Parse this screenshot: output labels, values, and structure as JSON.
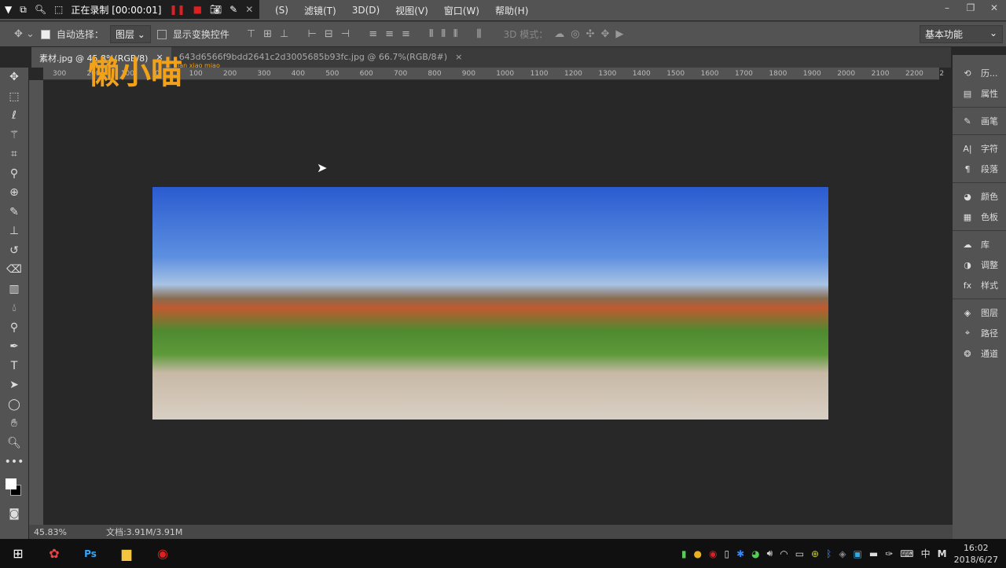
{
  "recorder": {
    "status": "正在录制 [00:00:01]"
  },
  "menu": [
    "(S)",
    "滤镜(T)",
    "3D(D)",
    "视图(V)",
    "窗口(W)",
    "帮助(H)"
  ],
  "options": {
    "auto_select_label": "自动选择：",
    "auto_select_checked": true,
    "target": "图层",
    "show_transform_label": "显示变换控件",
    "show_transform_checked": false,
    "mode3d_label": "3D 模式：",
    "workspace": "基本功能"
  },
  "tabs": [
    {
      "label": "素材.jpg @ 45.8%(RGB/8)",
      "active": true
    },
    {
      "label": "643d6566f9bdd2641c2d3005685b93fc.jpg @ 66.7%(RGB/8#)",
      "active": false
    }
  ],
  "ruler": [
    "300",
    "200",
    "100",
    "0",
    "100",
    "200",
    "300",
    "400",
    "500",
    "600",
    "700",
    "800",
    "900",
    "1000",
    "1100",
    "1200",
    "1300",
    "1400",
    "1500",
    "1600",
    "1700",
    "1800",
    "1900",
    "2000",
    "2100",
    "2200",
    "2"
  ],
  "watermark": {
    "text": "懒小喵",
    "sub": "lan xiao miao"
  },
  "panels": [
    {
      "icon": "history-icon",
      "label": "历..."
    },
    {
      "icon": "properties-icon",
      "label": "属性"
    },
    {
      "icon": "brush-icon",
      "label": "画笔"
    },
    {
      "icon": "character-icon",
      "label": "字符"
    },
    {
      "icon": "paragraph-icon",
      "label": "段落"
    },
    {
      "icon": "color-icon",
      "label": "颜色"
    },
    {
      "icon": "swatches-icon",
      "label": "色板"
    },
    {
      "icon": "libraries-icon",
      "label": "库"
    },
    {
      "icon": "adjustments-icon",
      "label": "调整"
    },
    {
      "icon": "styles-icon",
      "label": "样式"
    },
    {
      "icon": "layers-icon",
      "label": "图层"
    },
    {
      "icon": "paths-icon",
      "label": "路径"
    },
    {
      "icon": "channels-icon",
      "label": "通道"
    }
  ],
  "status": {
    "zoom": "45.83%",
    "doc": "文档:3.91M/3.91M"
  },
  "taskbar": {
    "time": "16:02",
    "date": "2018/6/27",
    "ime": "中",
    "ime_mode": "M"
  }
}
